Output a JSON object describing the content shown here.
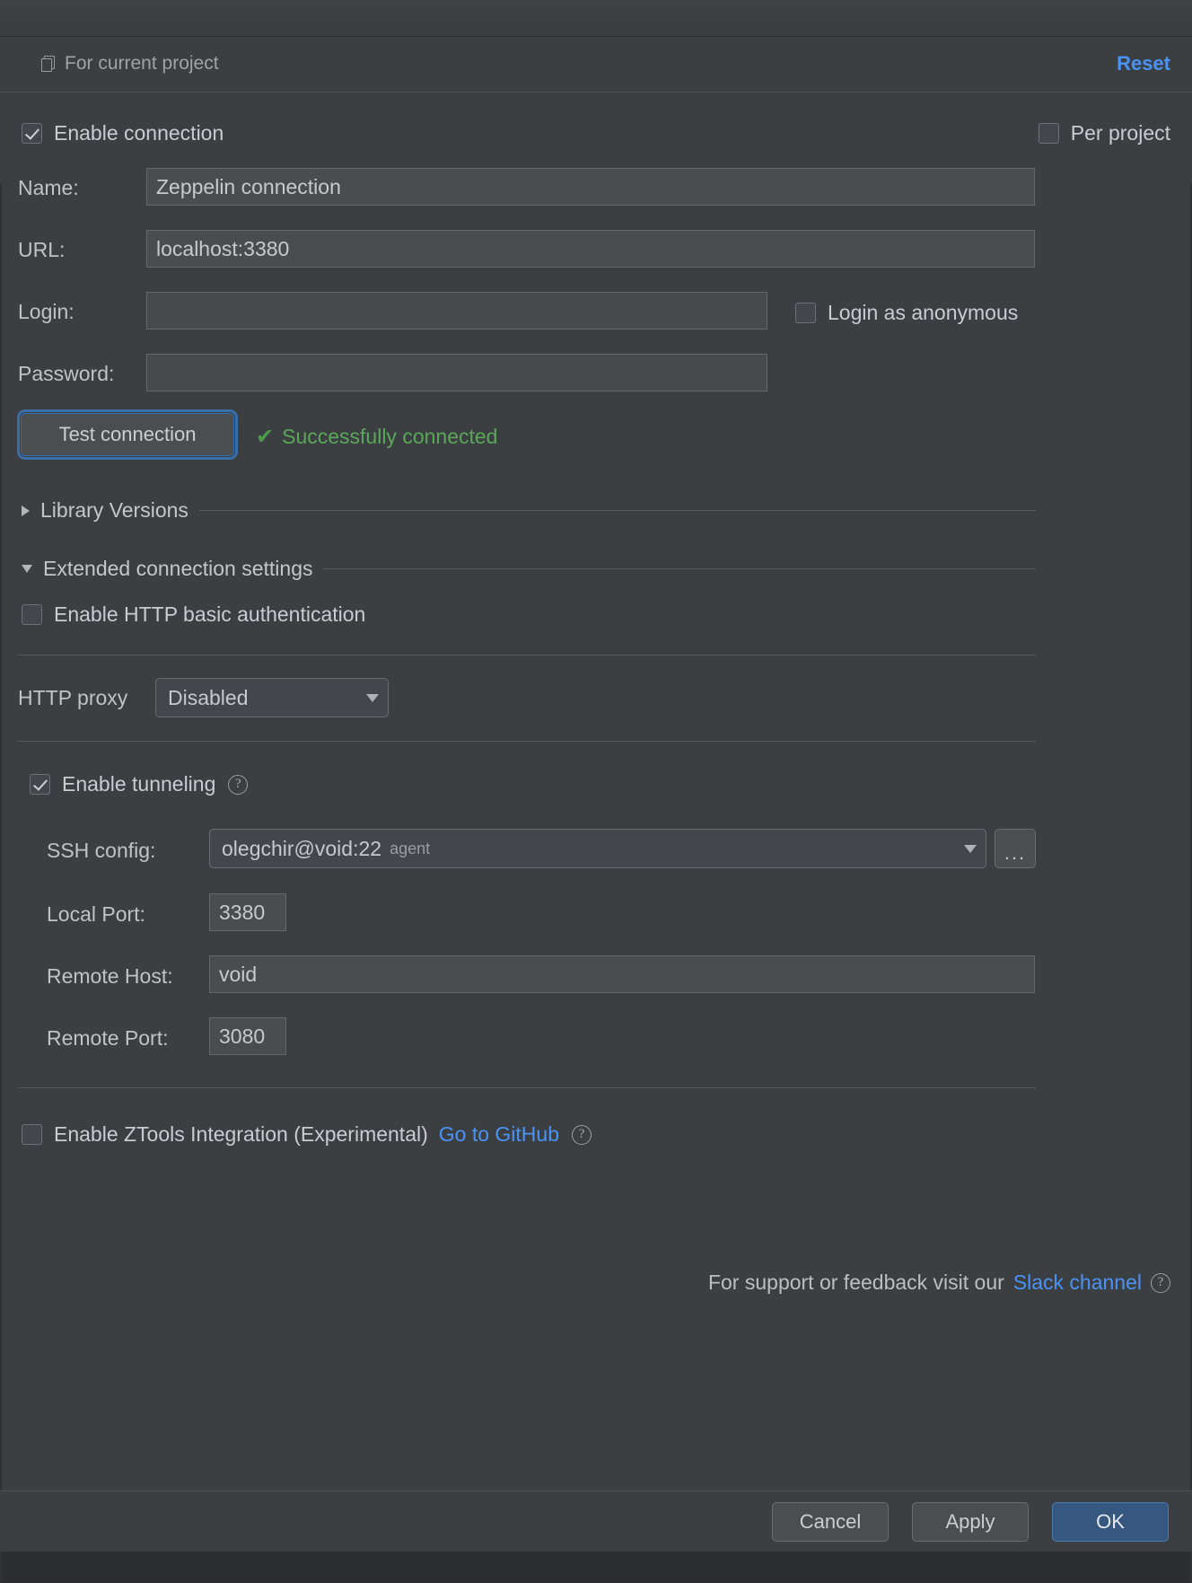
{
  "header": {
    "scope_label": "For current project",
    "scope_icon": "copy-project-icon",
    "reset_label": "Reset"
  },
  "form": {
    "enable_connection": {
      "label": "Enable connection",
      "checked": true
    },
    "per_project": {
      "label": "Per project",
      "checked": false
    },
    "name": {
      "label": "Name:",
      "value": "Zeppelin connection"
    },
    "url": {
      "label": "URL:",
      "value": "localhost:3380"
    },
    "login": {
      "label": "Login:",
      "value": ""
    },
    "login_anonymous": {
      "label": "Login as anonymous",
      "checked": false
    },
    "password": {
      "label": "Password:",
      "value": ""
    },
    "test_connection": {
      "label": "Test connection"
    },
    "connection_status": {
      "text": "Successfully connected",
      "icon": "check-icon",
      "color": "#5aa75a"
    }
  },
  "sections": {
    "library_versions": {
      "label": "Library Versions",
      "expanded": false
    },
    "extended_connection": {
      "label": "Extended connection settings",
      "expanded": true
    }
  },
  "extended": {
    "http_basic_auth": {
      "label": "Enable HTTP basic authentication",
      "checked": false
    },
    "http_proxy": {
      "label": "HTTP proxy",
      "value": "Disabled",
      "options": [
        "Disabled"
      ]
    }
  },
  "tunneling": {
    "enable": {
      "label": "Enable tunneling",
      "checked": true
    },
    "help_icon": "help-icon",
    "ssh_config": {
      "label": "SSH config:",
      "value": "olegchir@void:22",
      "suffix": "agent"
    },
    "browse_button": "...",
    "local_port": {
      "label": "Local Port:",
      "value": "3380"
    },
    "remote_host": {
      "label": "Remote Host:",
      "value": "void"
    },
    "remote_port": {
      "label": "Remote Port:",
      "value": "3080"
    }
  },
  "ztools": {
    "label": "Enable ZTools Integration (Experimental)",
    "checked": false,
    "link_label": "Go to GitHub",
    "help_icon": "help-icon"
  },
  "support": {
    "text": "For support or feedback visit our",
    "link_label": "Slack channel",
    "help_icon": "help-icon"
  },
  "footer": {
    "cancel": "Cancel",
    "apply": "Apply",
    "ok": "OK"
  },
  "colors": {
    "accent_link": "#4a93f5",
    "primary_button": "#365880",
    "status_success": "#5aa75a",
    "panel_bg": "#3c3f41"
  }
}
